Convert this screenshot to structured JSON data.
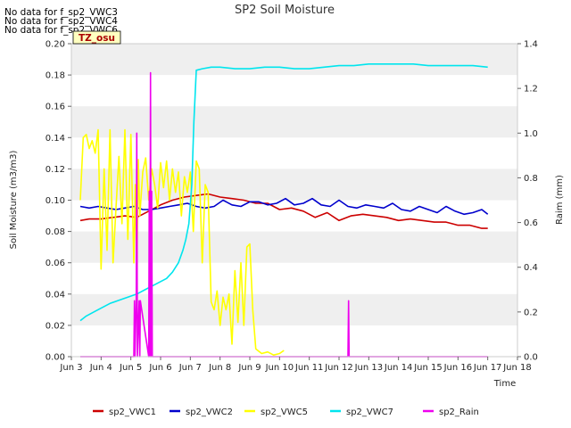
{
  "header_notes": [
    "No data for f_sp2_VWC3",
    "No data for f_sp2_VWC4",
    "No data for f_sp2_VWC6"
  ],
  "chart_data": {
    "type": "line",
    "title": "SP2 Soil Moisture",
    "xlabel": "Time",
    "ylabel": "Soil Moisture (m3/m3)",
    "y2label": "Raim (mm)",
    "tz_label": "TZ_osu",
    "xlim": [
      3,
      18
    ],
    "ylim": [
      0,
      0.2
    ],
    "y2lim": [
      0,
      1.4
    ],
    "x_ticks": [
      3,
      4,
      5,
      6,
      7,
      8,
      9,
      10,
      11,
      12,
      13,
      14,
      15,
      16,
      17,
      18
    ],
    "x_tick_labels": [
      "Jun 3",
      "Jun 4",
      "Jun 5",
      "Jun 6",
      "Jun 7",
      "Jun 8",
      "Jun 9",
      "Jun 10",
      "Jun 11",
      "Jun 12",
      "Jun 13",
      "Jun 14",
      "Jun 15",
      "Jun 16",
      "Jun 17",
      "Jun 18"
    ],
    "y_ticks": [
      0.0,
      0.02,
      0.04,
      0.06,
      0.08,
      0.1,
      0.12,
      0.14,
      0.16,
      0.18,
      0.2
    ],
    "y_tick_labels": [
      "0.00",
      "0.02",
      "0.04",
      "0.06",
      "0.08",
      "0.10",
      "0.12",
      "0.14",
      "0.16",
      "0.18",
      "0.20"
    ],
    "y2_ticks": [
      0.0,
      0.2,
      0.4,
      0.6,
      0.8,
      1.0,
      1.2,
      1.4
    ],
    "y2_tick_labels": [
      "0.0",
      "0.2",
      "0.4",
      "0.6",
      "0.8",
      "1.0",
      "1.2",
      "1.4"
    ],
    "grid": "horizontal bands",
    "legend_position": "bottom",
    "series": [
      {
        "name": "sp2_VWC1",
        "color": "#cc0000",
        "axis": "left",
        "x": [
          3.3,
          3.6,
          4.0,
          4.4,
          4.8,
          5.2,
          5.6,
          6.0,
          6.4,
          6.8,
          7.2,
          7.6,
          8.0,
          8.4,
          8.8,
          9.2,
          9.6,
          10.0,
          10.4,
          10.8,
          11.2,
          11.6,
          12.0,
          12.4,
          12.8,
          13.2,
          13.6,
          14.0,
          14.4,
          14.8,
          15.2,
          15.6,
          16.0,
          16.4,
          16.8,
          17.0
        ],
        "y": [
          0.087,
          0.088,
          0.088,
          0.089,
          0.09,
          0.089,
          0.093,
          0.097,
          0.1,
          0.102,
          0.103,
          0.104,
          0.102,
          0.101,
          0.1,
          0.098,
          0.098,
          0.094,
          0.095,
          0.093,
          0.089,
          0.092,
          0.087,
          0.09,
          0.091,
          0.09,
          0.089,
          0.087,
          0.088,
          0.087,
          0.086,
          0.086,
          0.084,
          0.084,
          0.082,
          0.082
        ]
      },
      {
        "name": "sp2_VWC2",
        "color": "#0000cc",
        "axis": "left",
        "x": [
          3.3,
          3.6,
          3.9,
          4.2,
          4.5,
          4.8,
          5.1,
          5.4,
          5.7,
          6.0,
          6.3,
          6.6,
          6.9,
          7.2,
          7.5,
          7.8,
          8.1,
          8.4,
          8.7,
          9.0,
          9.3,
          9.6,
          9.9,
          10.2,
          10.5,
          10.8,
          11.1,
          11.4,
          11.7,
          12.0,
          12.3,
          12.6,
          12.9,
          13.2,
          13.5,
          13.8,
          14.1,
          14.4,
          14.7,
          15.0,
          15.3,
          15.6,
          15.9,
          16.2,
          16.5,
          16.8,
          17.0
        ],
        "y": [
          0.096,
          0.095,
          0.096,
          0.095,
          0.094,
          0.095,
          0.096,
          0.094,
          0.094,
          0.095,
          0.096,
          0.097,
          0.098,
          0.096,
          0.095,
          0.096,
          0.1,
          0.097,
          0.096,
          0.099,
          0.099,
          0.097,
          0.098,
          0.101,
          0.097,
          0.098,
          0.101,
          0.097,
          0.096,
          0.1,
          0.096,
          0.095,
          0.097,
          0.096,
          0.095,
          0.098,
          0.094,
          0.093,
          0.096,
          0.094,
          0.092,
          0.096,
          0.093,
          0.091,
          0.092,
          0.094,
          0.091
        ]
      },
      {
        "name": "sp2_VWC5",
        "color": "#ffff00",
        "axis": "left",
        "x": [
          3.3,
          3.4,
          3.5,
          3.6,
          3.7,
          3.8,
          3.9,
          4.0,
          4.1,
          4.2,
          4.3,
          4.4,
          4.5,
          4.6,
          4.7,
          4.8,
          4.9,
          5.0,
          5.1,
          5.15,
          5.2,
          5.25,
          5.3,
          5.4,
          5.5,
          5.6,
          5.7,
          5.8,
          5.9,
          6.0,
          6.1,
          6.2,
          6.3,
          6.4,
          6.5,
          6.6,
          6.7,
          6.8,
          6.9,
          7.0,
          7.1,
          7.2,
          7.3,
          7.4,
          7.5,
          7.6,
          7.7,
          7.8,
          7.9,
          8.0,
          8.1,
          8.2,
          8.3,
          8.4,
          8.5,
          8.6,
          8.7,
          8.8,
          8.9,
          9.0,
          9.1,
          9.2,
          9.4,
          9.6,
          9.8,
          10.0,
          10.15
        ],
        "y": [
          0.1,
          0.14,
          0.142,
          0.133,
          0.138,
          0.13,
          0.145,
          0.056,
          0.12,
          0.068,
          0.145,
          0.06,
          0.095,
          0.128,
          0.085,
          0.145,
          0.075,
          0.142,
          0.06,
          0.11,
          0.055,
          0.126,
          0.09,
          0.118,
          0.127,
          0.1,
          0.12,
          0.11,
          0.095,
          0.124,
          0.108,
          0.125,
          0.1,
          0.12,
          0.105,
          0.118,
          0.09,
          0.115,
          0.105,
          0.118,
          0.08,
          0.125,
          0.12,
          0.06,
          0.11,
          0.105,
          0.035,
          0.03,
          0.042,
          0.02,
          0.038,
          0.03,
          0.04,
          0.008,
          0.055,
          0.022,
          0.06,
          0.02,
          0.07,
          0.072,
          0.03,
          0.005,
          0.002,
          0.003,
          0.001,
          0.002,
          0.004
        ]
      },
      {
        "name": "sp2_VWC7",
        "color": "#00e5ee",
        "axis": "left",
        "x": [
          3.3,
          3.5,
          3.8,
          4.0,
          4.3,
          4.6,
          4.9,
          5.2,
          5.5,
          5.8,
          6.0,
          6.2,
          6.4,
          6.6,
          6.75,
          6.85,
          6.95,
          7.05,
          7.12,
          7.2,
          7.4,
          7.7,
          8.0,
          8.5,
          9.0,
          9.5,
          10.0,
          10.5,
          11.0,
          11.5,
          12.0,
          12.5,
          13.0,
          13.5,
          14.0,
          14.5,
          15.0,
          15.5,
          16.0,
          16.5,
          17.0
        ],
        "y": [
          0.023,
          0.026,
          0.029,
          0.031,
          0.034,
          0.036,
          0.038,
          0.04,
          0.043,
          0.046,
          0.048,
          0.05,
          0.054,
          0.06,
          0.068,
          0.075,
          0.085,
          0.11,
          0.15,
          0.183,
          0.184,
          0.185,
          0.185,
          0.184,
          0.184,
          0.185,
          0.185,
          0.184,
          0.184,
          0.185,
          0.186,
          0.186,
          0.187,
          0.187,
          0.187,
          0.187,
          0.186,
          0.186,
          0.186,
          0.186,
          0.185
        ]
      },
      {
        "name": "sp2_Rain",
        "color": "#ee00ee",
        "axis": "right",
        "x": [
          3.3,
          5.0,
          5.1,
          5.12,
          5.14,
          5.18,
          5.2,
          5.22,
          5.28,
          5.3,
          5.32,
          5.6,
          5.62,
          5.64,
          5.66,
          5.68,
          5.7,
          5.72,
          12.3,
          12.32,
          12.34,
          12.36,
          17.0
        ],
        "y": [
          0,
          0,
          0,
          0.25,
          0,
          0.25,
          1.0,
          0,
          0.25,
          0,
          0.25,
          0,
          0.74,
          0,
          1.27,
          0,
          0.74,
          0,
          0,
          0.25,
          0,
          0,
          0
        ]
      }
    ]
  }
}
